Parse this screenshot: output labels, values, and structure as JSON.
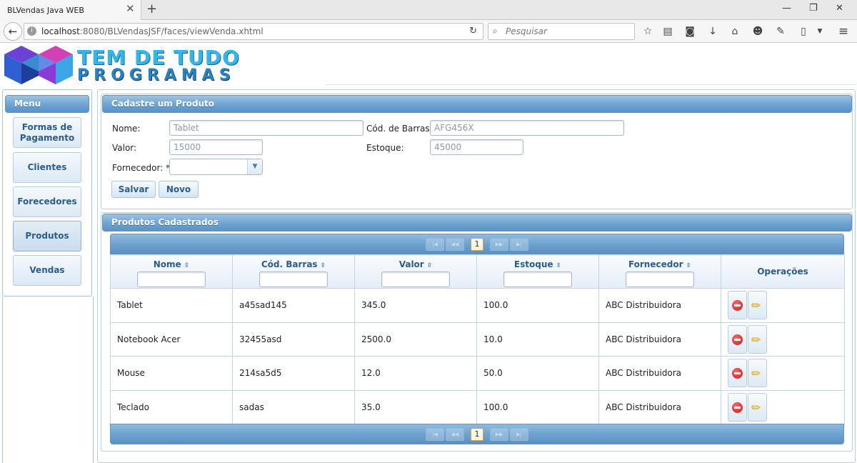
{
  "browser": {
    "tab_title": "BLVendas Java WEB",
    "url_host": "localhost",
    "url_path": ":8080/BLVendasJSF/faces/viewVenda.xhtml",
    "search_placeholder": "Pesquisar"
  },
  "logo": {
    "line1": "TEM DE TUDO",
    "line2": "PROGRAMAS"
  },
  "menu": {
    "title": "Menu",
    "items": [
      "Formas de Pagamento",
      "Clientes",
      "Forecedores",
      "Produtos",
      "Vendas"
    ],
    "active": "Produtos"
  },
  "form": {
    "title": "Cadastre um Produto",
    "nome_label": "Nome:",
    "nome_value": "Tablet",
    "codbarras_label": "Cód. de Barras:",
    "codbarras_value": "AFG456X",
    "valor_label": "Valor:",
    "valor_value": "15000",
    "estoque_label": "Estoque:",
    "estoque_value": "45000",
    "fornecedor_label": "Fornecedor: *",
    "fornecedor_value": "",
    "salvar_label": "Salvar",
    "novo_label": "Novo"
  },
  "grid": {
    "title": "Produtos Cadastrados",
    "current_page": "1",
    "columns": [
      "Nome",
      "Cód. Barras",
      "Valor",
      "Estoque",
      "Fornecedor",
      "Operações"
    ],
    "rows": [
      [
        "Tablet",
        "a45sad145",
        "345.0",
        "100.0",
        "ABC Distribuidora"
      ],
      [
        "Notebook Acer",
        "32455asd",
        "2500.0",
        "10.0",
        "ABC Distribuidora"
      ],
      [
        "Mouse",
        "214sa5d5",
        "12.0",
        "50.0",
        "ABC Distribuidora"
      ],
      [
        "Teclado",
        "sadas",
        "35.0",
        "100.0",
        "ABC Distribuidora"
      ]
    ]
  },
  "colors": {
    "header_blue": "#6fa3d1",
    "button_text": "#2b5c8a",
    "logo_cyan": "#35b6e8"
  }
}
